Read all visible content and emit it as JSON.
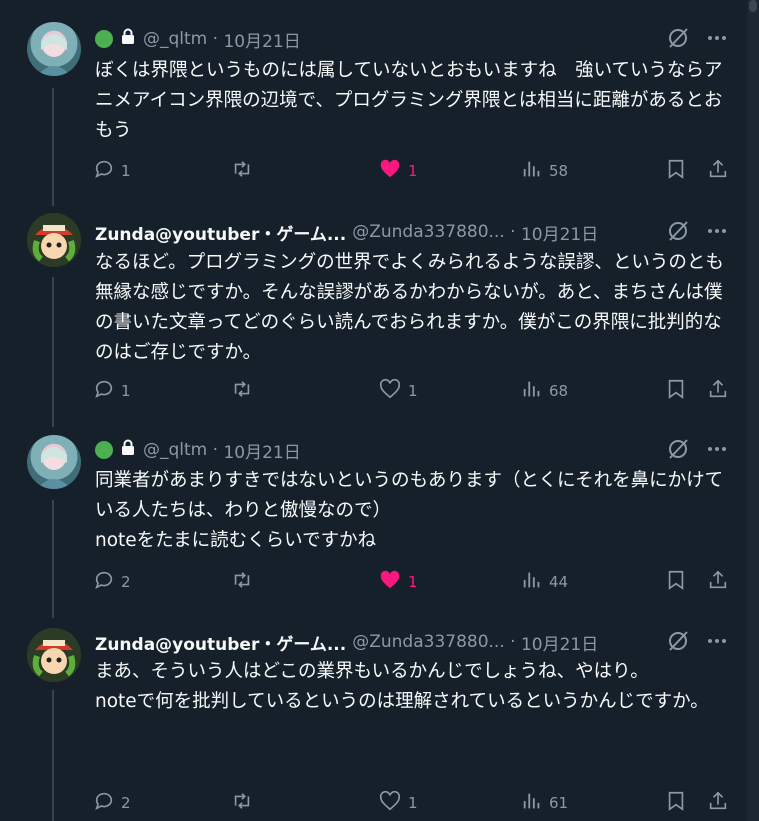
{
  "tweets": [
    {
      "name": "",
      "handle": "@_qltm",
      "date": "10月21日",
      "text": "ぼくは界隈というものには属していないとおもいますね　強いていうならアニメアイコン界隈の辺境で、プログラミング界隈とは相当に距離があるとおもう",
      "reply_count": "1",
      "retweet_count": "",
      "like_count": "1",
      "liked": true,
      "view_count": "58"
    },
    {
      "name": "Zunda@youtuber・ゲーム...",
      "handle": "@Zunda337880...",
      "date": "10月21日",
      "text": "なるほど。プログラミングの世界でよくみられるような誤謬、というのとも無縁な感じですか。そんな誤謬があるかわからないが。あと、まちさんは僕の書いた文章ってどのぐらい読んでおられますか。僕がこの界隈に批判的なのはご存じですか。",
      "reply_count": "1",
      "retweet_count": "",
      "like_count": "1",
      "liked": false,
      "view_count": "68"
    },
    {
      "name": "",
      "handle": "@_qltm",
      "date": "10月21日",
      "text": "同業者があまりすきではないというのもあります（とくにそれを鼻にかけている人たちは、わりと傲慢なので）\nnoteをたまに読むくらいですかね",
      "reply_count": "2",
      "retweet_count": "",
      "like_count": "1",
      "liked": true,
      "view_count": "44"
    },
    {
      "name": "Zunda@youtuber・ゲーム...",
      "handle": "@Zunda337880...",
      "date": "10月21日",
      "text": "まあ、そういう人はどこの業界もいるかんじでしょうね、やはり。\nnoteで何を批判しているというのは理解されているというかんじですか。",
      "reply_count": "2",
      "retweet_count": "",
      "like_count": "1",
      "liked": false,
      "view_count": "61"
    }
  ],
  "colors": {
    "background": "#15202b",
    "text": "#f7f9f9",
    "muted": "#8b98a5",
    "like": "#f91880",
    "status_dot": "#4caf50"
  },
  "icons": [
    "reply-icon",
    "retweet-icon",
    "heart-icon",
    "views-icon",
    "bookmark-icon",
    "share-icon",
    "grok-icon",
    "more-icon",
    "lock-icon"
  ]
}
